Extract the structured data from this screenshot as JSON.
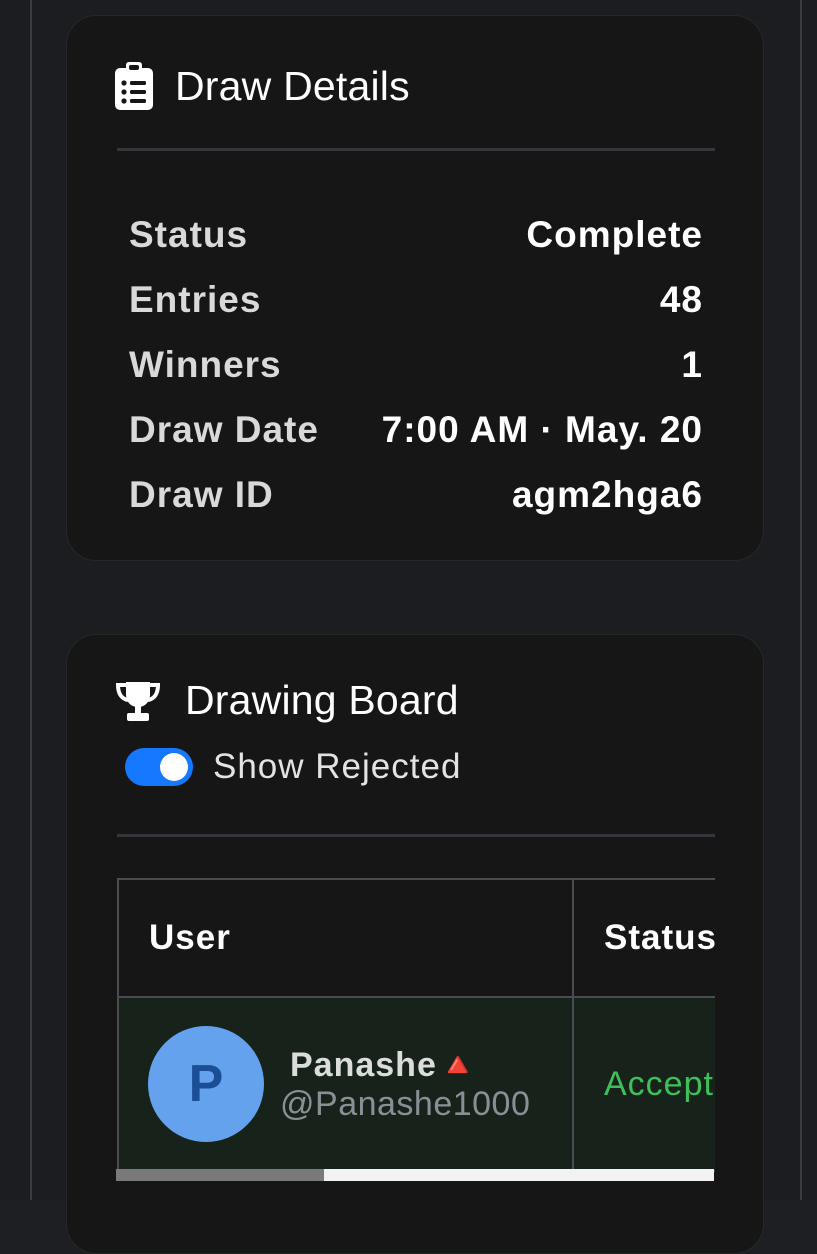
{
  "draw_details": {
    "title": "Draw Details",
    "icon": "clipboard-icon",
    "rows": [
      {
        "label": "Status",
        "value": "Complete"
      },
      {
        "label": "Entries",
        "value": "48"
      },
      {
        "label": "Winners",
        "value": "1"
      },
      {
        "label": "Draw Date",
        "value": "7:00 AM · May. 20"
      },
      {
        "label": "Draw ID",
        "value": "agm2hga6"
      }
    ]
  },
  "drawing_board": {
    "title": "Drawing Board",
    "icon": "trophy-icon",
    "toggle": {
      "label": "Show Rejected",
      "on": true
    },
    "columns": [
      "User",
      "Status"
    ],
    "entries": [
      {
        "avatar_letter": "P",
        "name": "Panashe🔺",
        "handle": "@Panashe1000",
        "status": "Accepted"
      }
    ]
  },
  "colors": {
    "accent": "#1677ff",
    "accepted": "#3fbf5a",
    "avatar_bg": "#64a2ee"
  }
}
